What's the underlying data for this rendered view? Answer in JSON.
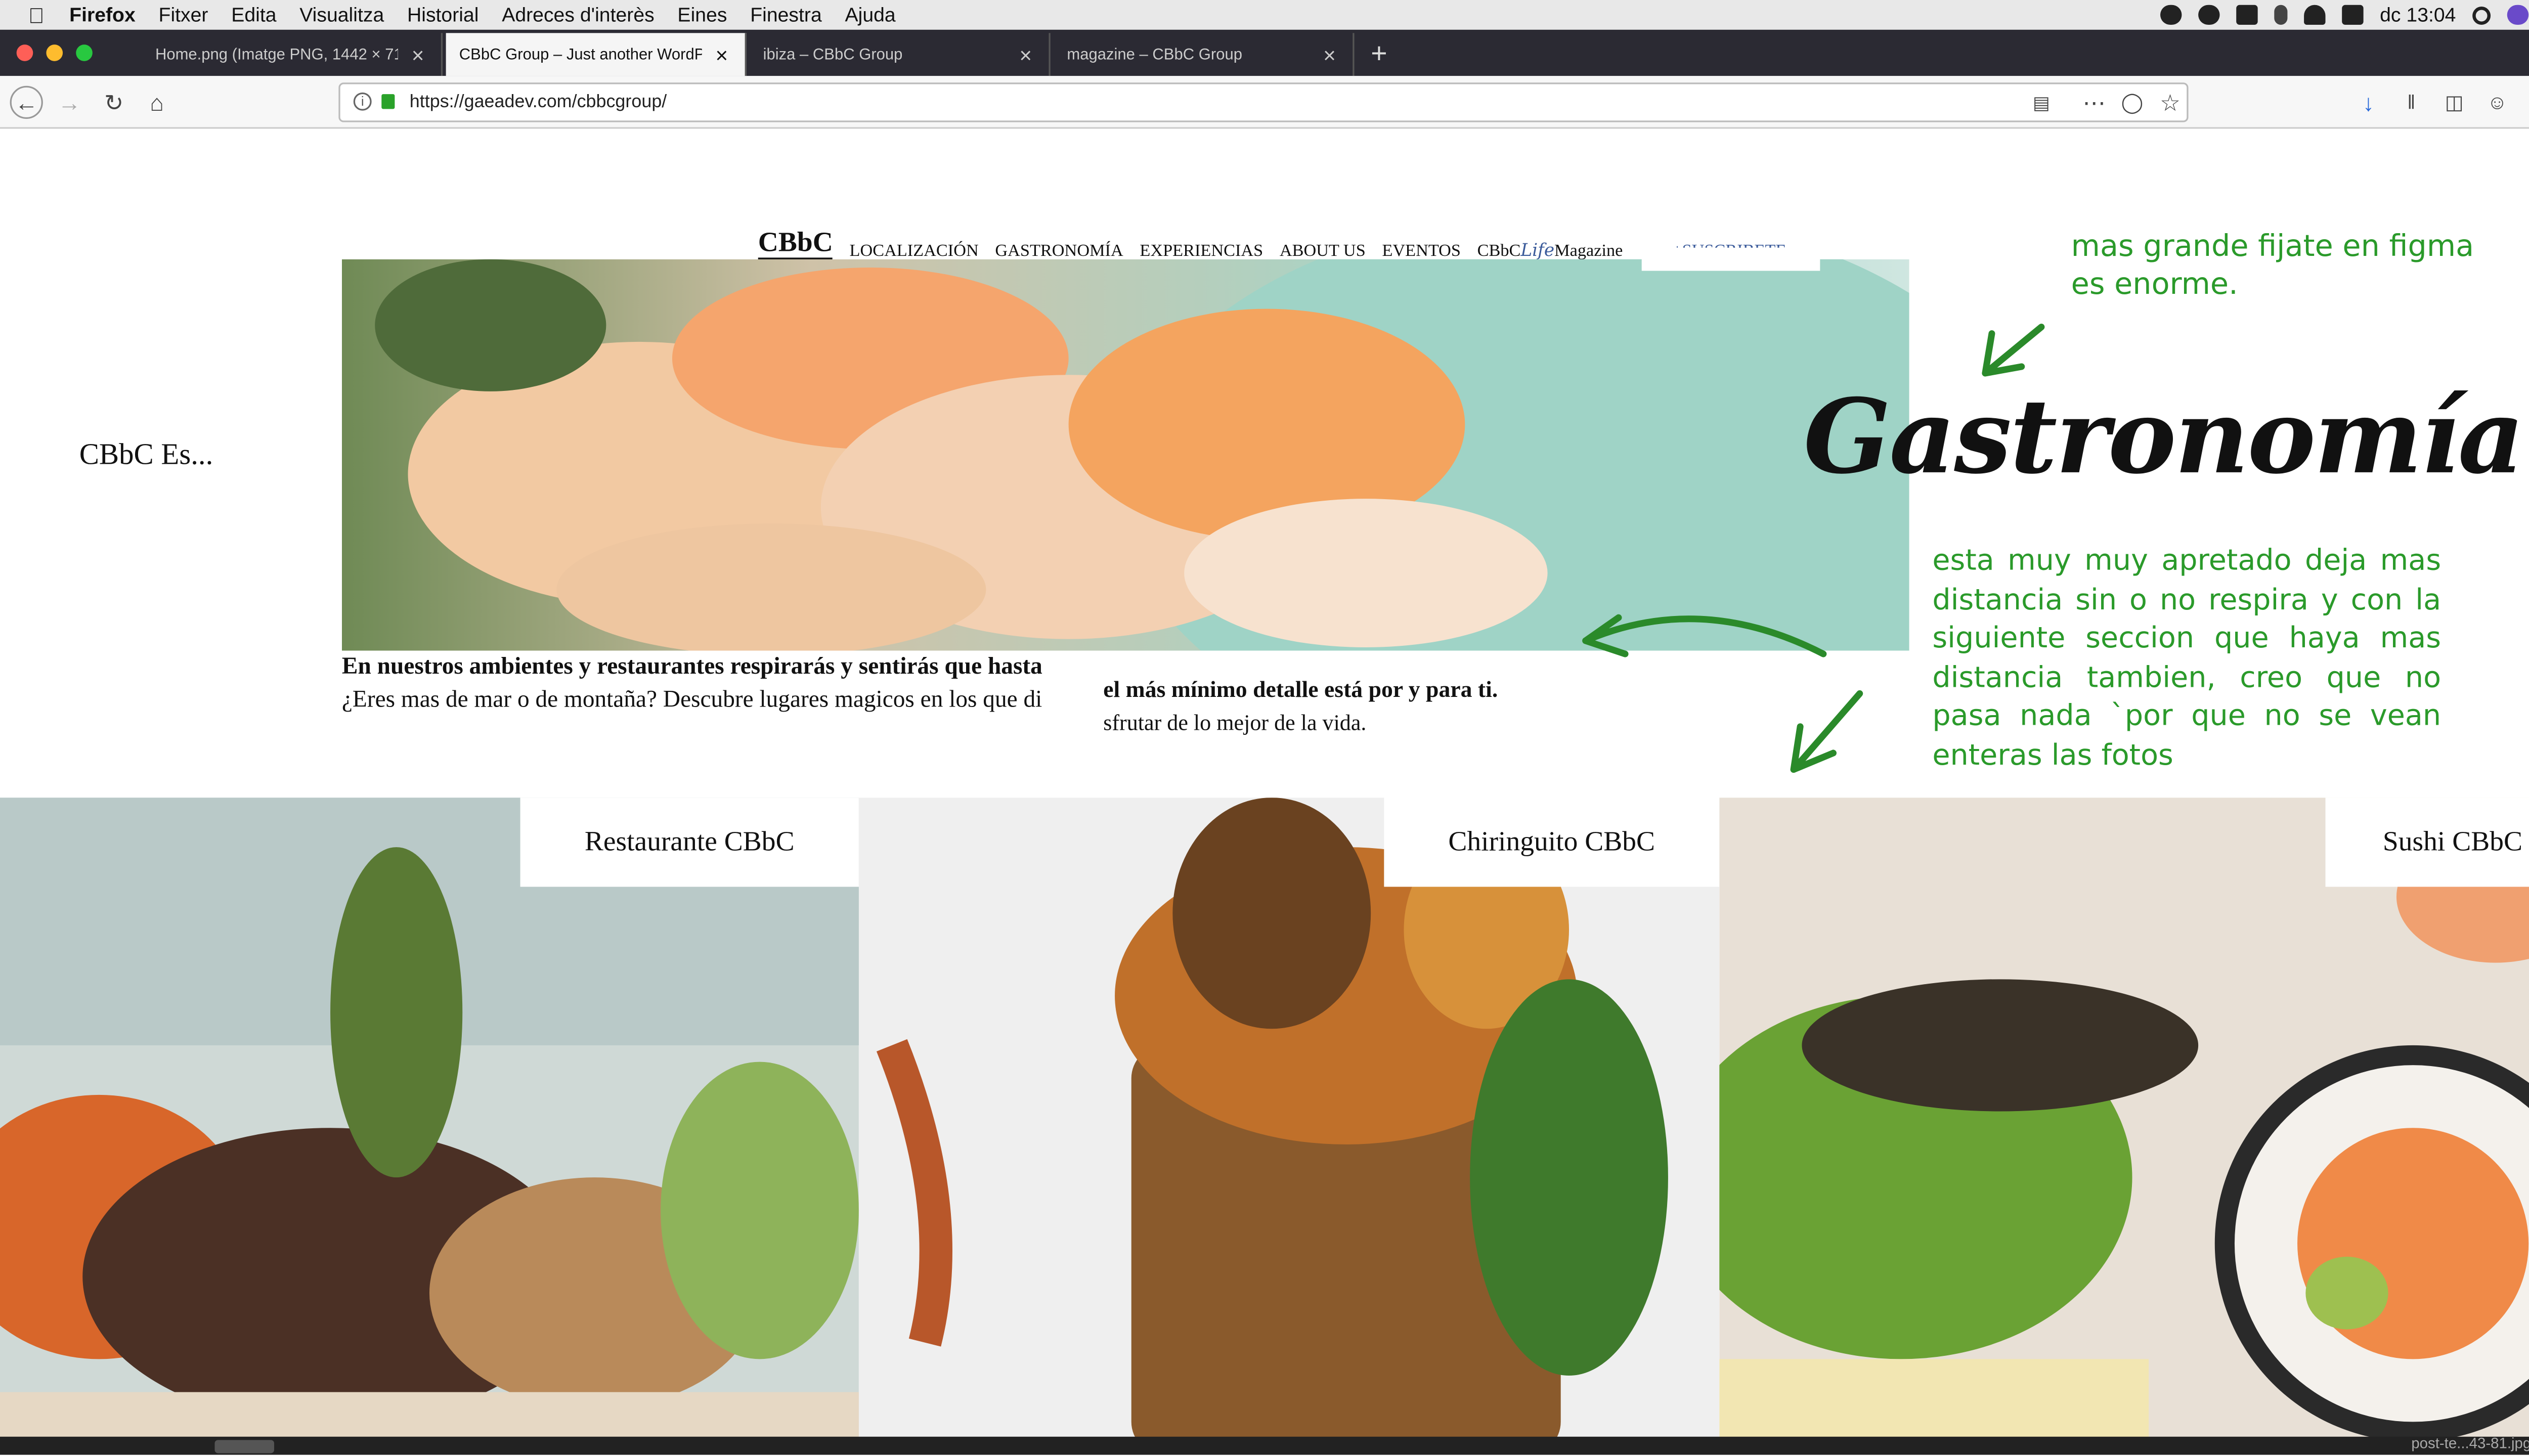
{
  "menubar": {
    "app": "Firefox",
    "items": [
      "Fitxer",
      "Edita",
      "Visualitza",
      "Historial",
      "Adreces d'interès",
      "Eines",
      "Finestra",
      "Ajuda"
    ],
    "clock": "dc 13:04"
  },
  "tabs": [
    {
      "title": "Home.png (Imatge PNG, 1442 × 71",
      "active": false
    },
    {
      "title": "CBbC Group – Just another WordPr",
      "active": true
    },
    {
      "title": "ibiza – CBbC Group",
      "active": false
    },
    {
      "title": "magazine – CBbC Group",
      "active": false
    }
  ],
  "new_tab_label": "+",
  "url": "https://gaeadev.com/cbbcgroup/",
  "site": {
    "logo": "CBbC",
    "nav": [
      "LOCALIZACIÓN",
      "GASTRONOMÍA",
      "EXPERIENCIAS",
      "ABOUT US",
      "EVENTOS"
    ],
    "magazine_prefix": "CBbC",
    "magazine_script": "Life",
    "magazine_suffix": "Magazine",
    "subscribe": "+SUSCRIBETE",
    "side_title": "CBbC Es...",
    "headline": "Gastronomía",
    "intro_line1": "En nuestros ambientes y restaurantes respirarás y sentirás que hasta",
    "intro_line2": "¿Eres mas de mar o de montaña? Descubre lugares magicos en los que di",
    "intro_line3": "el más mínimo detalle está por y para ti.",
    "intro_line4": "sfrutar de lo mejor de la vida.",
    "tiles": [
      "Restaurante CBbC",
      "Chiringuito CBbC",
      "Sushi CBbC"
    ]
  },
  "notes": {
    "top": "mas grande fijate en figma es enorme.",
    "right": "esta muy muy apretado deja mas distancia sin o no respira y con la siguiente seccion que haya mas distancia tambien, creo que no pasa nada `por que no se vean enteras las fotos"
  },
  "status_filename": "post-te...43-81.jpg",
  "colors": {
    "annotation": "#2a9a2a",
    "tabbar": "#2b2a33",
    "subscribe": "#3a5a9a"
  }
}
